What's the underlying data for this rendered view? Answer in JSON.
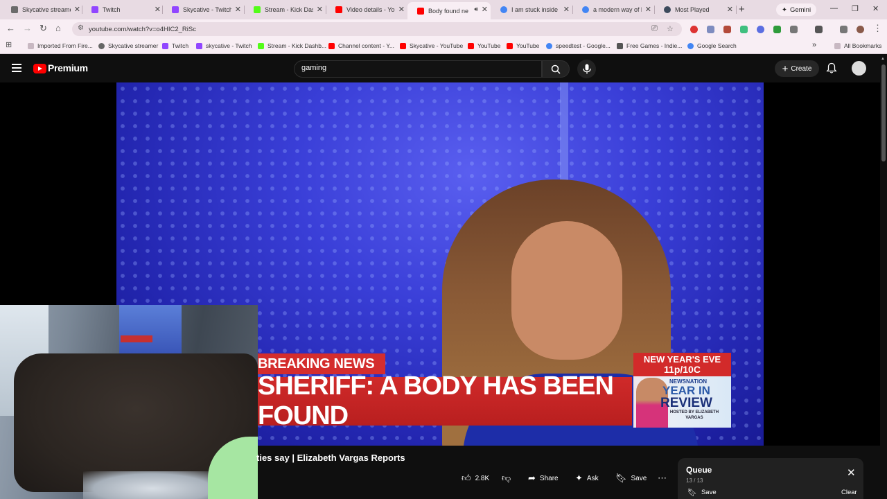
{
  "browser": {
    "tabs": [
      {
        "title": "Skycative streamer",
        "color": "#6b6b6b"
      },
      {
        "title": "Twitch",
        "color": "#9146ff"
      },
      {
        "title": "Skycative - Twitch",
        "color": "#9146ff"
      },
      {
        "title": "Stream - Kick Dash",
        "color": "#53fc18"
      },
      {
        "title": "Video details - You",
        "color": "#ff0000"
      },
      {
        "title": "Body found ne",
        "color": "#ff0000"
      },
      {
        "title": "I am stuck inside th",
        "color": "#4285f4"
      },
      {
        "title": "a modern way of le",
        "color": "#4285f4"
      },
      {
        "title": "Most Played",
        "color": "#3c4a5c"
      }
    ],
    "active_tab_index": 5,
    "gemini_label": "Gemini",
    "url": "youtube.com/watch?v=o4HIC2_RiSc",
    "bookmarks": [
      "Imported From Fire...",
      "Skycative streamer",
      "Twitch",
      "skycative - Twitch",
      "Stream - Kick Dashb...",
      "Channel content - Y...",
      "Skycative - YouTube",
      "YouTube",
      "YouTube",
      "speedtest - Google...",
      "Free Games - Indie...",
      "Google Search"
    ],
    "all_bookmarks_label": "All Bookmarks"
  },
  "youtube": {
    "brand": "Premium",
    "search_value": "gaming",
    "create_label": "Create"
  },
  "video": {
    "breaking_label": "BREAKING NEWS",
    "headline": "SHERIFF: A BODY HAS BEEN FOUND",
    "promo_line1": "NEW YEAR'S EVE",
    "promo_line2": "11p/10C",
    "promo_brand": "NEWSNATION",
    "promo_title1": "YEAR IN",
    "promo_title2": "REVIEW",
    "promo_host": "HOSTED BY ELIZABETH VARGAS",
    "title_visible": "ties say | Elizabeth Vargas Reports"
  },
  "actions": {
    "likes": "2.8K",
    "share": "Share",
    "ask": "Ask",
    "save": "Save",
    "more": "⋯"
  },
  "queue": {
    "title": "Queue",
    "count": "13 / 13",
    "save": "Save",
    "clear": "Clear"
  },
  "colors": {
    "youtube_red": "#ff0000",
    "breaking_red": "#d42d2d",
    "tab_bar": "#e8dbe3"
  }
}
